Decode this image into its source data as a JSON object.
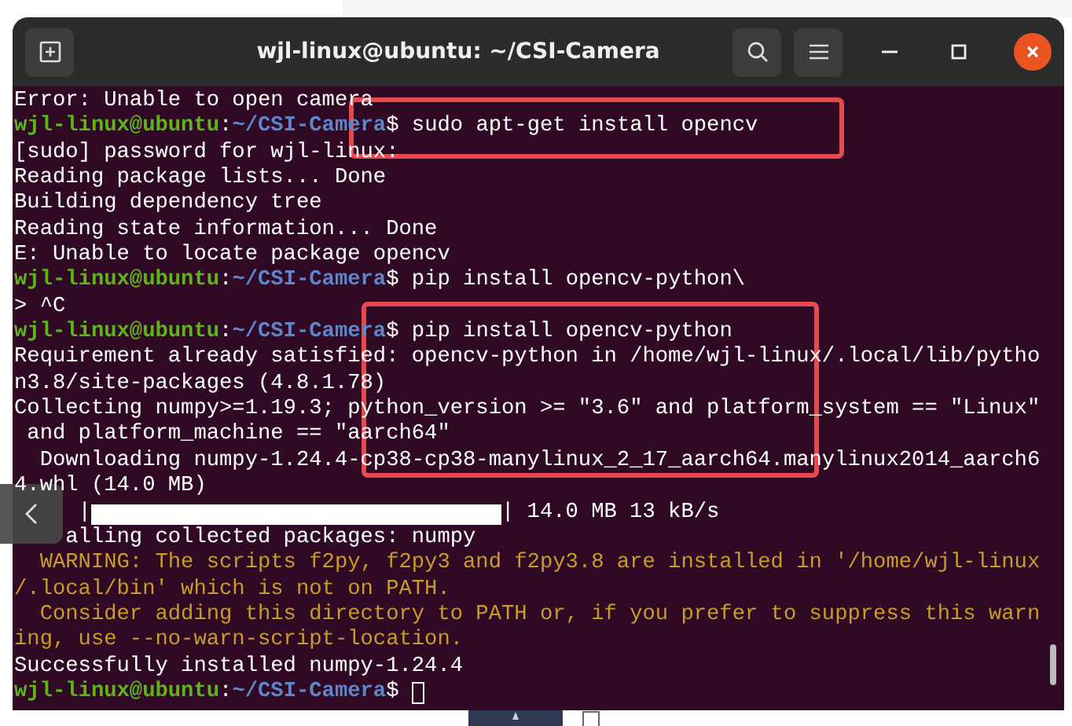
{
  "window": {
    "title": "wjl-linux@ubuntu: ~/CSI-Camera"
  },
  "terminal": {
    "lines": [
      {
        "kind": "output",
        "text": "Error: Unable to open camera"
      },
      {
        "kind": "prompt",
        "user": "wjl-linux@ubuntu",
        "sep": ":",
        "path": "~/CSI-Camera",
        "command": "$ sudo apt-get install opencv"
      },
      {
        "kind": "output",
        "text": "[sudo] password for wjl-linux: "
      },
      {
        "kind": "output",
        "text": "Reading package lists... Done"
      },
      {
        "kind": "output",
        "text": "Building dependency tree"
      },
      {
        "kind": "output",
        "text": "Reading state information... Done"
      },
      {
        "kind": "output",
        "text": "E: Unable to locate package opencv"
      },
      {
        "kind": "prompt",
        "user": "wjl-linux@ubuntu",
        "sep": ":",
        "path": "~/CSI-Camera",
        "command": "$ pip install opencv-python\\"
      },
      {
        "kind": "output",
        "text": "> ^C"
      },
      {
        "kind": "prompt",
        "user": "wjl-linux@ubuntu",
        "sep": ":",
        "path": "~/CSI-Camera",
        "command": "$ pip install opencv-python"
      },
      {
        "kind": "output",
        "text": "Requirement already satisfied: opencv-python in /home/wjl-linux/.local/lib/pytho"
      },
      {
        "kind": "output",
        "text": "n3.8/site-packages (4.8.1.78)"
      },
      {
        "kind": "output",
        "text": "Collecting numpy>=1.19.3; python_version >= \"3.6\" and platform_system == \"Linux\""
      },
      {
        "kind": "output",
        "text": " and platform_machine == \"aarch64\""
      },
      {
        "kind": "output",
        "text": "  Downloading numpy-1.24.4-cp38-cp38-manylinux_2_17_aarch64.manylinux2014_aarch6"
      },
      {
        "kind": "output",
        "text": "4.whl (14.0 MB)"
      },
      {
        "kind": "progress",
        "prefix": "|",
        "level": 1,
        "suffix": "| 14.0 MB 13 kB/s"
      },
      {
        "kind": "output",
        "text": "    alling collected packages: numpy"
      },
      {
        "kind": "warning",
        "text": "  WARNING: The scripts f2py, f2py3 and f2py3.8 are installed in '/home/wjl-linux"
      },
      {
        "kind": "warning",
        "text": "/.local/bin' which is not on PATH."
      },
      {
        "kind": "warning",
        "text": "  Consider adding this directory to PATH or, if you prefer to suppress this warn"
      },
      {
        "kind": "warning",
        "text": "ing, use --no-warn-script-location."
      },
      {
        "kind": "output",
        "text": "Successfully installed numpy-1.24.4"
      },
      {
        "kind": "prompt",
        "user": "wjl-linux@ubuntu",
        "sep": ":",
        "path": "~/CSI-Camera",
        "command": "$ ",
        "cursor": true
      }
    ]
  }
}
